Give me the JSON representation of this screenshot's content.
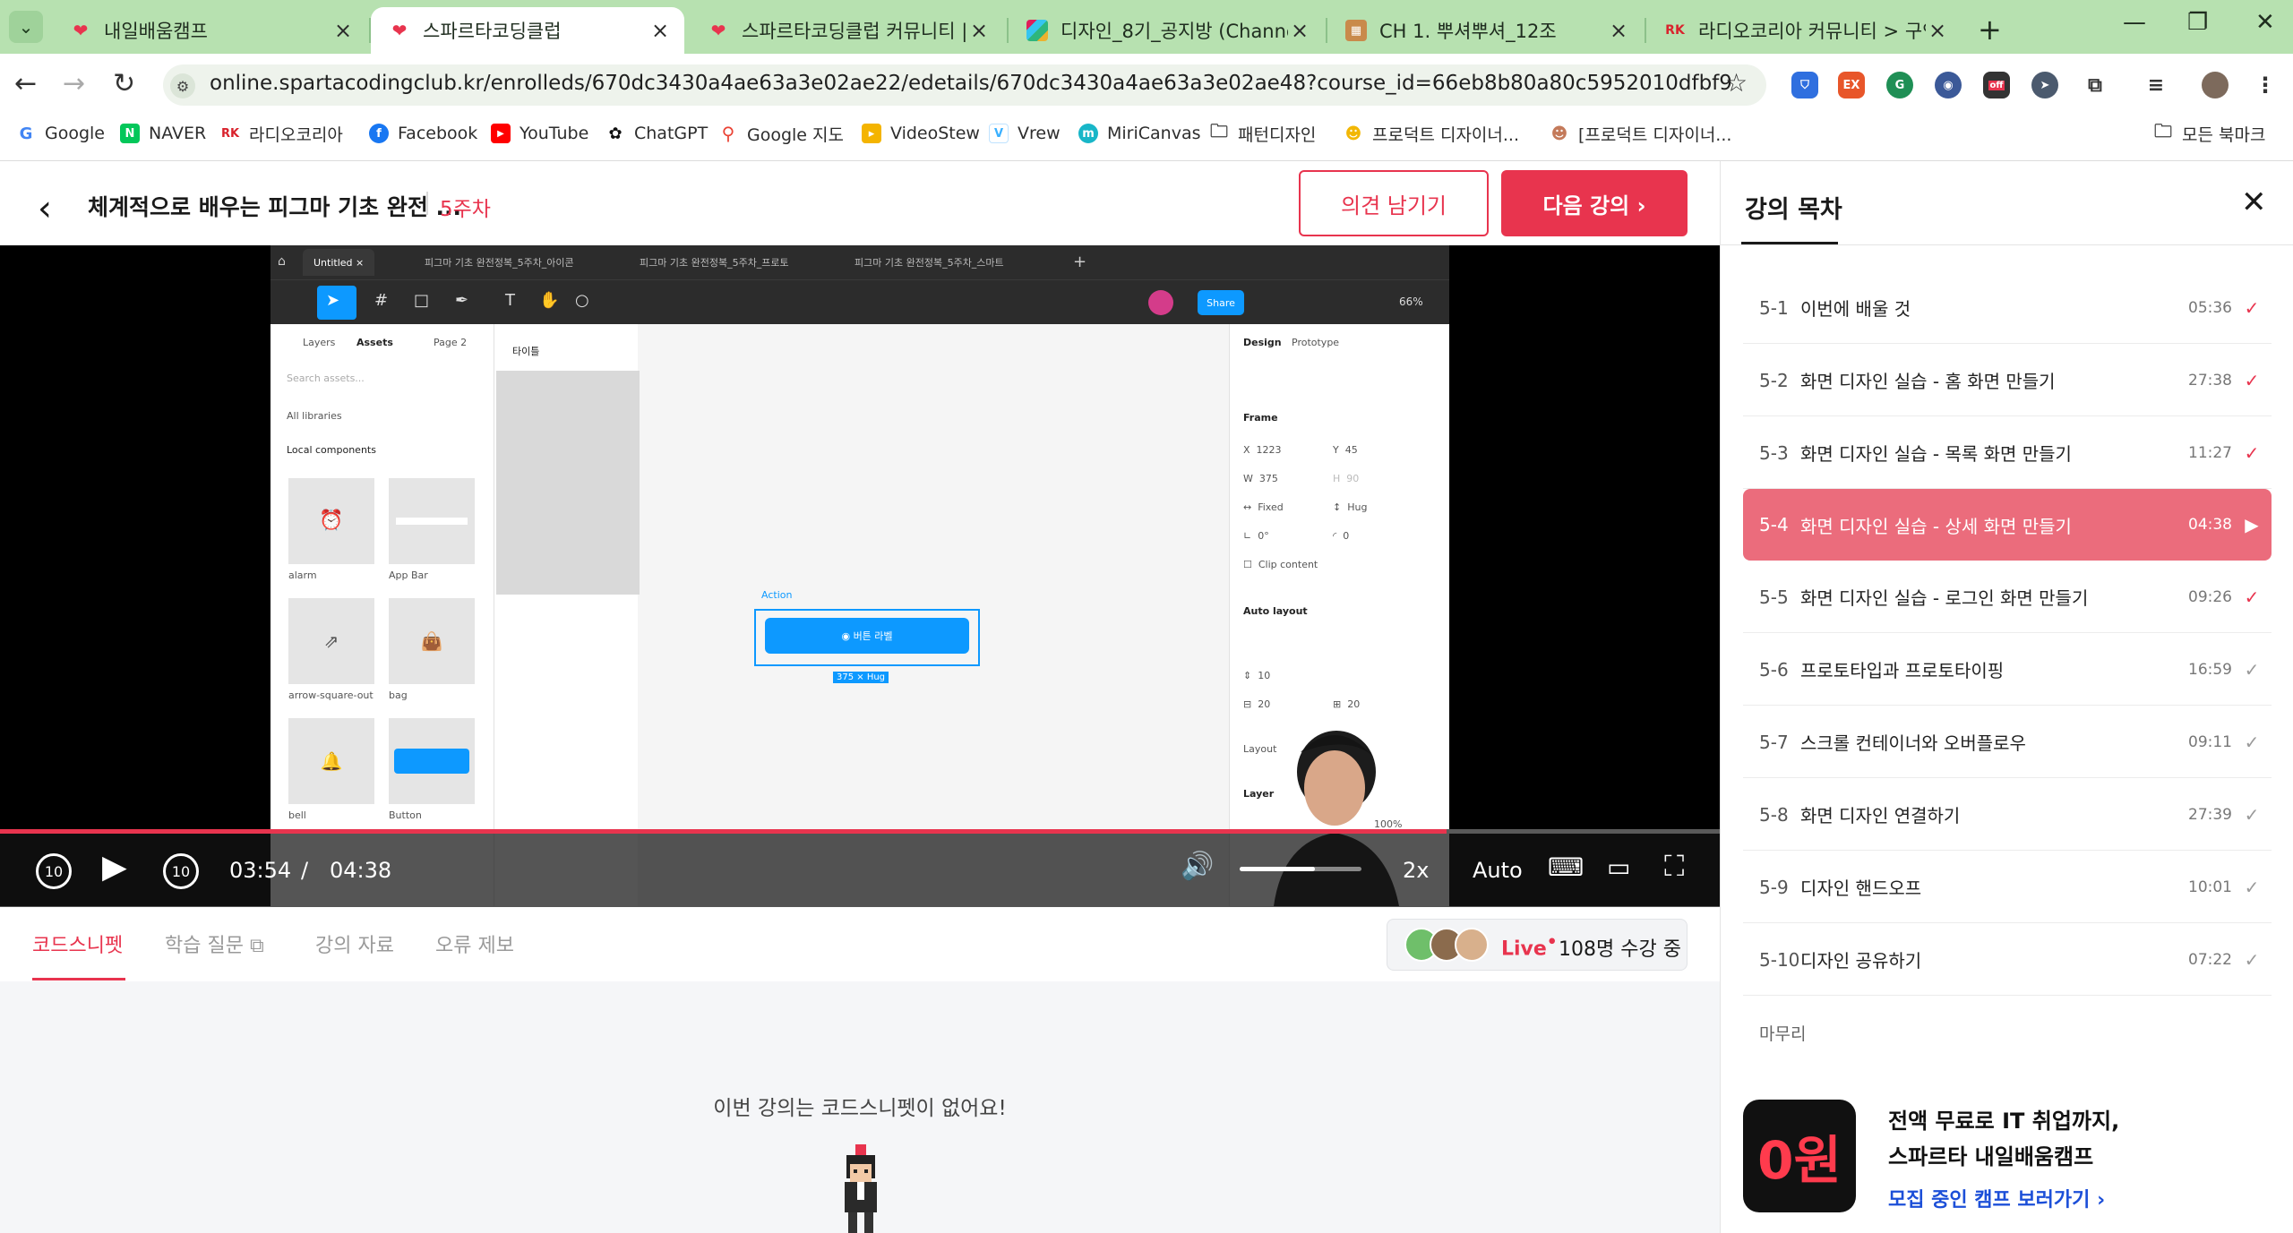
{
  "browser": {
    "tabs": [
      {
        "title": "내일배움캠프",
        "active": false
      },
      {
        "title": "스파르타코딩클럽",
        "active": true
      },
      {
        "title": "스파르타코딩클럽 커뮤니티 | 스",
        "active": false
      },
      {
        "title": "디자인_8기_공지방 (Channel) -",
        "active": false
      },
      {
        "title": "CH 1. 뿌셔뿌셔_12조",
        "active": false
      },
      {
        "title": "라디오코리아 커뮤니티 > 구인",
        "active": false
      }
    ],
    "url": "online.spartacodingclub.kr/enrolleds/670dc3430a4ae63a3e02ae22/edetails/670dc3430a4ae63a3e02ae48?course_id=66eb8b80a80c5952010dfbf9",
    "extensions": [
      "EX",
      "off"
    ],
    "bookmarks": [
      {
        "label": "Google",
        "icon": "google-icon"
      },
      {
        "label": "NAVER",
        "icon": "naver-icon"
      },
      {
        "label": "라디오코리아",
        "icon": "rk-icon"
      },
      {
        "label": "Facebook",
        "icon": "facebook-icon"
      },
      {
        "label": "YouTube",
        "icon": "youtube-icon"
      },
      {
        "label": "ChatGPT",
        "icon": "chatgpt-icon"
      },
      {
        "label": "Google 지도",
        "icon": "maps-icon"
      },
      {
        "label": "VideoStew",
        "icon": "videostew-icon"
      },
      {
        "label": "Vrew",
        "icon": "vrew-icon"
      },
      {
        "label": "MiriCanvas",
        "icon": "miricanvas-icon"
      },
      {
        "label": "패턴디자인",
        "icon": "folder-icon"
      },
      {
        "label": "프로덕트 디자이너...",
        "icon": "emoji-icon"
      },
      {
        "label": "[프로덕트 디자이너...",
        "icon": "emoji-icon"
      }
    ],
    "all_bookmarks": "모든 북마크"
  },
  "header": {
    "course_title": "체계적으로 배우는 피그마 기초 완전 ...",
    "week": "5주차",
    "feedback_button": "의견 남기기",
    "next_button": "다음 강의"
  },
  "player": {
    "current_time": "03:54",
    "time_sep": "/",
    "duration": "04:38",
    "progress": 0.841,
    "volume": 0.62,
    "speed": "2x",
    "quality": "Auto",
    "skip_back": "10",
    "skip_forward": "10"
  },
  "figma": {
    "tabs": [
      "Untitled",
      "피그마 기초 완전정복_5주차_아이콘",
      "피그마 기초 완전정복_5주차_프로토",
      "피그마 기초 완전정복_5주차_스마트"
    ],
    "share": "Share",
    "zoom": "66%",
    "left_tabs": [
      "Layers",
      "Assets",
      "Page 2"
    ],
    "search_placeholder": "Search assets...",
    "libraries": "All libraries",
    "local_components": "Local components",
    "components": [
      "alarm",
      "App Bar",
      "arrow-square-out",
      "bag",
      "bell",
      "Button"
    ],
    "frame_label": "타이틀",
    "right_tabs": [
      "Design",
      "Prototype"
    ],
    "frame_section": "Frame",
    "x": "1223",
    "y": "45",
    "w": "375",
    "h": "90",
    "fixed": "Fixed",
    "hug": "Hug",
    "rotation": "0°",
    "radius": "0",
    "clip": "Clip content",
    "auto_layout": "Auto layout",
    "gap": "10",
    "pad1": "20",
    "pad2": "20",
    "layout": "Layout",
    "layer": "Layer",
    "layer_opacity": "100%",
    "action_label": "Action",
    "action_button": "버튼 라벨",
    "hug_badge": "375 × Hug"
  },
  "content_tabs": [
    {
      "label": "코드스니펫",
      "active": true
    },
    {
      "label": "학습 질문",
      "active": false
    },
    {
      "label": "강의 자료",
      "active": false
    },
    {
      "label": "오류 제보",
      "active": false
    }
  ],
  "live": {
    "label": "Live",
    "count": "108명 수강 중"
  },
  "empty_message": "이번 강의는 코드스니펫이 없어요!",
  "sidebar": {
    "title": "강의 목차",
    "lessons": [
      {
        "num": "5-1",
        "title": "이번에 배울 것",
        "duration": "05:36",
        "status": "done"
      },
      {
        "num": "5-2",
        "title": "화면 디자인 실습 - 홈 화면 만들기",
        "duration": "27:38",
        "status": "done"
      },
      {
        "num": "5-3",
        "title": "화면 디자인 실습 - 목록 화면 만들기",
        "duration": "11:27",
        "status": "done"
      },
      {
        "num": "5-4",
        "title": "화면 디자인 실습 - 상세 화면 만들기",
        "duration": "04:38",
        "status": "playing"
      },
      {
        "num": "5-5",
        "title": "화면 디자인 실습 - 로그인 화면 만들기",
        "duration": "09:26",
        "status": "done"
      },
      {
        "num": "5-6",
        "title": "프로토타입과 프로토타이핑",
        "duration": "16:59",
        "status": "todo"
      },
      {
        "num": "5-7",
        "title": "스크롤 컨테이너와 오버플로우",
        "duration": "09:11",
        "status": "todo"
      },
      {
        "num": "5-8",
        "title": "화면 디자인 연결하기",
        "duration": "27:39",
        "status": "todo"
      },
      {
        "num": "5-9",
        "title": "디자인 핸드오프",
        "duration": "10:01",
        "status": "todo"
      },
      {
        "num": "5-10",
        "title": "디자인 공유하기",
        "duration": "07:22",
        "status": "todo"
      }
    ],
    "finale": "마무리",
    "promo": {
      "logo_text": "0원",
      "line1": "전액 무료로 IT 취업까지,",
      "line2": "스파르타 내일배움캠프",
      "link": "모집 중인 캠프 보러가기"
    }
  },
  "colors": {
    "accent": "#e8344e",
    "active_lesson": "#eb6c7c",
    "tab_strip": "#b7e1b0",
    "link": "#1c4fd8"
  }
}
